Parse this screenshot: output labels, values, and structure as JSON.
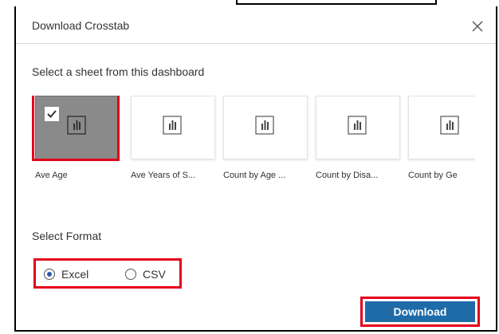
{
  "dialog": {
    "title": "Download Crosstab"
  },
  "sheets": {
    "heading": "Select a sheet from this dashboard",
    "items": [
      {
        "label": "Ave Age",
        "selected": true
      },
      {
        "label": "Ave Years of S...",
        "selected": false
      },
      {
        "label": "Count by Age ...",
        "selected": false
      },
      {
        "label": "Count by Disa...",
        "selected": false
      },
      {
        "label": "Count by Ge",
        "selected": false
      }
    ]
  },
  "format": {
    "heading": "Select Format",
    "options": [
      {
        "label": "Excel",
        "selected": true
      },
      {
        "label": "CSV",
        "selected": false
      }
    ]
  },
  "actions": {
    "download_label": "Download"
  },
  "colors": {
    "accent": "#1f6ba8",
    "highlight": "#e3001b",
    "selected_thumb": "#8a8a8a"
  },
  "icons": {
    "close": "close-icon",
    "chart": "bar-chart-icon",
    "check": "check-icon"
  }
}
